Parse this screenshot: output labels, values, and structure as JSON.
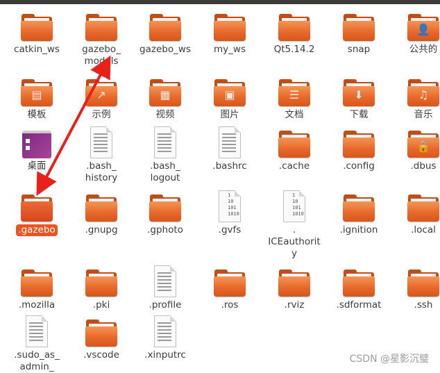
{
  "colors": {
    "folder": "#e8692b",
    "accent": "#e95420",
    "arrow": "#e8211b",
    "topbar": "#3c3b37"
  },
  "items": [
    {
      "name": "catkin_ws",
      "type": "folder"
    },
    {
      "name": "gazebo_\nmodels",
      "type": "folder"
    },
    {
      "name": "gazebo_ws",
      "type": "folder"
    },
    {
      "name": "my_ws",
      "type": "folder"
    },
    {
      "name": "Qt5.14.2",
      "type": "folder"
    },
    {
      "name": "snap",
      "type": "folder"
    },
    {
      "name": "公共的",
      "type": "folder",
      "emblem": "person-icon"
    },
    {
      "name": "模板",
      "type": "folder",
      "emblem": "template-icon"
    },
    {
      "name": "示例",
      "type": "folder",
      "emblem": "link-arrow-icon"
    },
    {
      "name": "视频",
      "type": "folder",
      "emblem": "film-icon"
    },
    {
      "name": "图片",
      "type": "folder",
      "emblem": "picture-icon"
    },
    {
      "name": "文档",
      "type": "folder",
      "emblem": "document-icon"
    },
    {
      "name": "下载",
      "type": "folder",
      "emblem": "download-icon"
    },
    {
      "name": "音乐",
      "type": "folder",
      "emblem": "music-icon"
    },
    {
      "name": "桌面",
      "type": "desktop"
    },
    {
      "name": ".bash_\nhistory",
      "type": "text"
    },
    {
      "name": ".bash_\nlogout",
      "type": "text"
    },
    {
      "name": ".bashrc",
      "type": "text"
    },
    {
      "name": ".cache",
      "type": "folder"
    },
    {
      "name": ".config",
      "type": "folder"
    },
    {
      "name": ".dbus",
      "type": "folder",
      "emblem": "lock-icon"
    },
    {
      "name": ".gazebo",
      "type": "folder",
      "selected": true
    },
    {
      "name": ".gnupg",
      "type": "folder"
    },
    {
      "name": ".gphoto",
      "type": "folder"
    },
    {
      "name": ".gvfs",
      "type": "binary"
    },
    {
      "name": ".\nICEauthorit\ny",
      "type": "binary"
    },
    {
      "name": ".ignition",
      "type": "folder"
    },
    {
      "name": ".local",
      "type": "folder"
    },
    {
      "name": ".mozilla",
      "type": "folder"
    },
    {
      "name": ".pki",
      "type": "folder"
    },
    {
      "name": ".profile",
      "type": "text"
    },
    {
      "name": ".ros",
      "type": "folder"
    },
    {
      "name": ".rviz",
      "type": "folder"
    },
    {
      "name": ".sdformat",
      "type": "folder"
    },
    {
      "name": ".ssh",
      "type": "folder"
    },
    {
      "name": ".sudo_as_\nadmin_",
      "type": "text"
    },
    {
      "name": ".vscode",
      "type": "folder"
    },
    {
      "name": ".xinputrc",
      "type": "text"
    }
  ],
  "binary_text": [
    "1",
    "10",
    "101",
    "1010"
  ],
  "watermark": "CSDN @星影沉璧"
}
